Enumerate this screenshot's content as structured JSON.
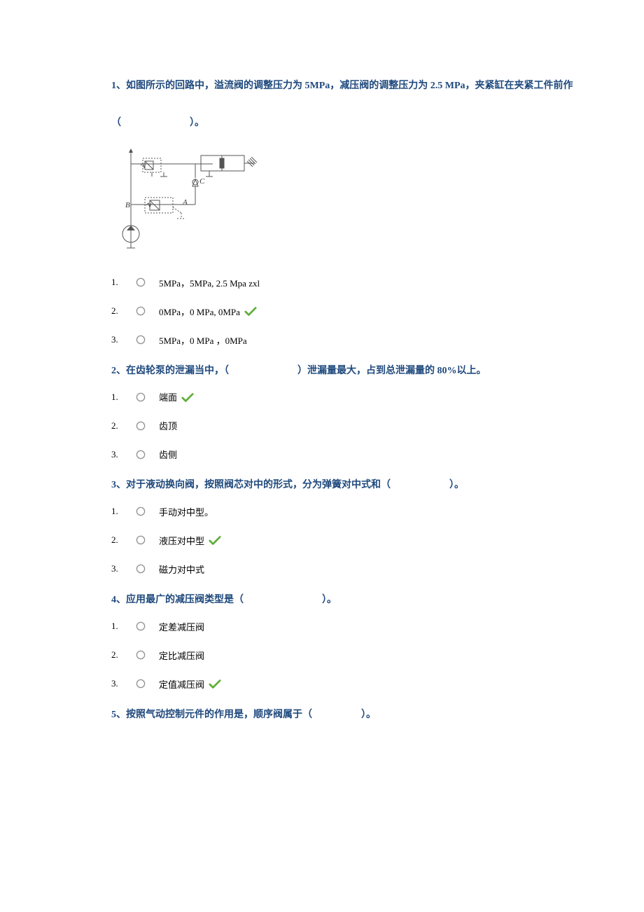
{
  "questions": [
    {
      "prompt_line1": "1、如图所示的回路中，溢流阀的调整压力为 5MPa，减压阀的调整压力为 2.5 MPa，夹紧缸在夹紧工件前作",
      "prompt_line2": "（　　　　　　　）。",
      "has_diagram": true,
      "options": [
        {
          "n": "1.",
          "text": "5MPa，5MPa, 2.5 Mpa zxl",
          "correct": false
        },
        {
          "n": "2.",
          "text": "0MPa，0 MPa, 0MPa",
          "correct": true
        },
        {
          "n": "3.",
          "text": "5MPa，0 MPa ，0MPa",
          "correct": false
        }
      ]
    },
    {
      "prompt_line1": "2、在齿轮泵的泄漏当中，（　　　　　　　）泄漏量最大，占到总泄漏量的 80%以上。",
      "options": [
        {
          "n": "1.",
          "text": "端面",
          "correct": true
        },
        {
          "n": "2.",
          "text": "齿顶",
          "correct": false
        },
        {
          "n": "3.",
          "text": "齿侧",
          "correct": false
        }
      ]
    },
    {
      "prompt_line1": "3、对于液动换向阀，按照阀芯对中的形式，分为弹簧对中式和（　　　　　　）。",
      "options": [
        {
          "n": "1.",
          "text": "手动对中型。",
          "correct": false
        },
        {
          "n": "2.",
          "text": "液压对中型",
          "correct": true
        },
        {
          "n": "3.",
          "text": "磁力对中式",
          "correct": false
        }
      ]
    },
    {
      "prompt_line1": "4、应用最广的减压阀类型是（　　　　　　　　）。",
      "options": [
        {
          "n": "1.",
          "text": "定差减压阀",
          "correct": false
        },
        {
          "n": "2.",
          "text": "定比减压阀",
          "correct": false
        },
        {
          "n": "3.",
          "text": "定值减压阀",
          "correct": true
        }
      ]
    },
    {
      "prompt_line1": "5、按照气动控制元件的作用是，顺序阀属于（　　　　　）。",
      "options": []
    }
  ],
  "diagram_labels": {
    "B": "B",
    "A": "A",
    "C": "C"
  }
}
